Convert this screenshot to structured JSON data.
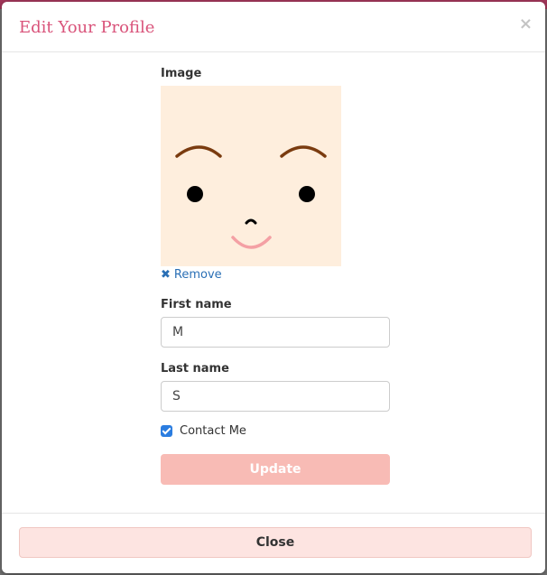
{
  "modal": {
    "title": "Edit Your Profile",
    "close_icon": "×",
    "image_label": "Image",
    "remove_label": "Remove",
    "first_name_label": "First name",
    "first_name_value": "M",
    "last_name_label": "Last name",
    "last_name_value": "S",
    "contact_label": "Contact Me",
    "contact_checked": true,
    "update_label": "Update",
    "close_label": "Close"
  },
  "icons": {
    "close": "close-icon",
    "remove": "remove-x-icon",
    "checkbox": "checkmark-icon"
  },
  "colors": {
    "title": "#d9537a",
    "avatar_bg": "#feeedd",
    "link": "#2a6fb5",
    "update_bg": "#f8bbb5",
    "close_bg": "#fde4e1",
    "checkbox": "#2b7de0"
  }
}
